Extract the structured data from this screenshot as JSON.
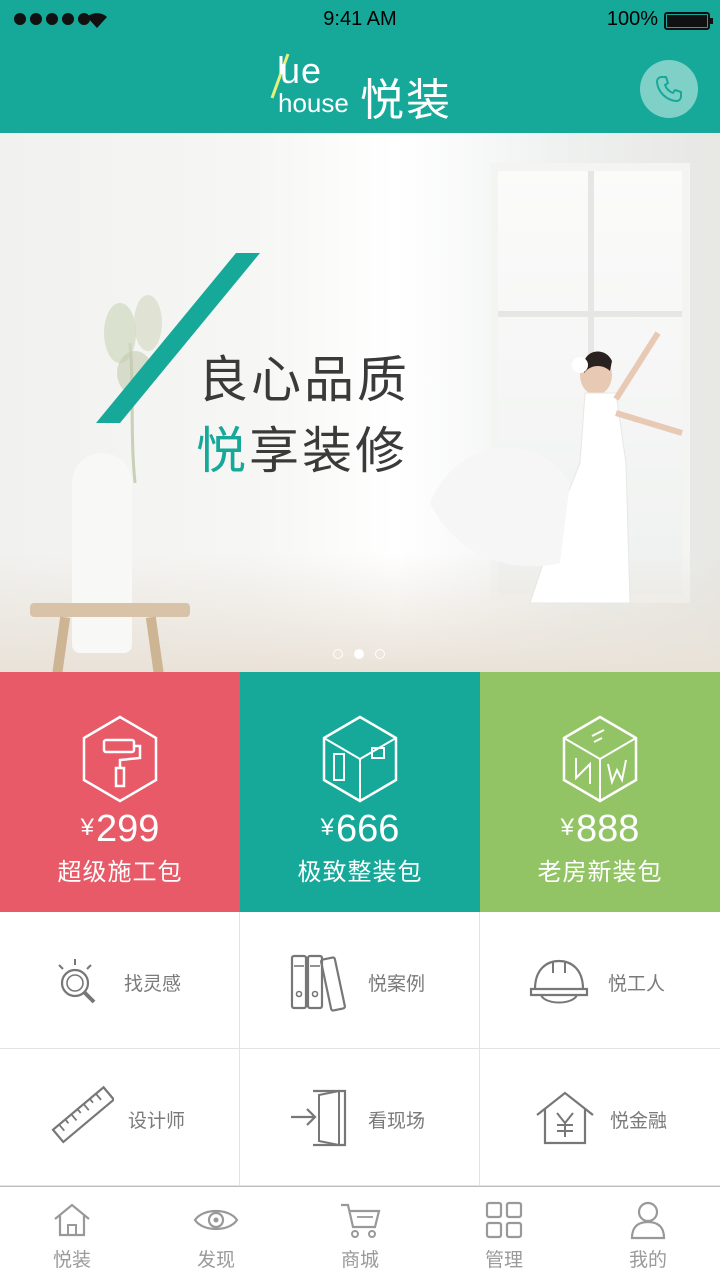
{
  "status_bar": {
    "time": "9:41 AM",
    "battery": "100%"
  },
  "header": {
    "logo_en_top": "ue",
    "logo_en_bottom": "house",
    "logo_cn": "悦装",
    "phone_icon": "phone-icon",
    "accent": "#16a99a"
  },
  "banner": {
    "line1": "良心品质",
    "line2_highlight": "悦",
    "line2_rest": "享装修",
    "page_count": 3,
    "active_page": 2
  },
  "packages": [
    {
      "price_symbol": "¥",
      "price": "299",
      "name": "超级施工包",
      "color": "#e85a67",
      "icon": "paint-roller-icon"
    },
    {
      "price_symbol": "¥",
      "price": "666",
      "name": "极致整装包",
      "color": "#16a99a",
      "icon": "room-cube-icon"
    },
    {
      "price_symbol": "¥",
      "price": "888",
      "name": "老房新装包",
      "color": "#92c466",
      "icon": "new-cube-icon"
    }
  ],
  "services": [
    {
      "label": "找灵感",
      "icon": "magnifier-bulb-icon"
    },
    {
      "label": "悦案例",
      "icon": "binders-icon"
    },
    {
      "label": "悦工人",
      "icon": "hard-hat-icon"
    },
    {
      "label": "设计师",
      "icon": "ruler-icon"
    },
    {
      "label": "看现场",
      "icon": "door-enter-icon"
    },
    {
      "label": "悦金融",
      "icon": "house-yen-icon"
    }
  ],
  "tabs": [
    {
      "label": "悦装",
      "icon": "home-icon"
    },
    {
      "label": "发现",
      "icon": "eye-icon"
    },
    {
      "label": "商城",
      "icon": "cart-icon"
    },
    {
      "label": "管理",
      "icon": "grid-icon"
    },
    {
      "label": "我的",
      "icon": "user-icon"
    }
  ]
}
